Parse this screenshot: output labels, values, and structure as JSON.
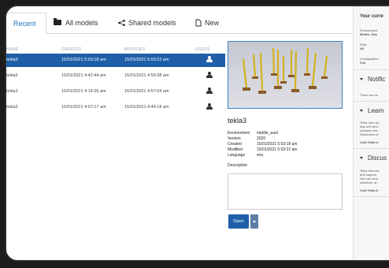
{
  "tabs": [
    {
      "label": "Recent",
      "icon": "clock-icon"
    },
    {
      "label": "All models",
      "icon": "folder-icon"
    },
    {
      "label": "Shared models",
      "icon": "share-icon"
    },
    {
      "label": "New",
      "icon": "new-document-icon"
    }
  ],
  "table": {
    "columns": [
      "NAME",
      "CREATED",
      "MODIFIED",
      "USERS"
    ],
    "rows": [
      {
        "name": "tekla3",
        "created": "15/01/2021 5:03:18 am",
        "modified": "15/01/2021 5:03:22 am",
        "selected": true
      },
      {
        "name": "tekla2",
        "created": "15/01/2021 4:42:44 am",
        "modified": "15/01/2021 4:59:38 am",
        "selected": false
      },
      {
        "name": "tekla1",
        "created": "15/01/2021 4:14:36 am",
        "modified": "15/01/2021 4:57:04 am",
        "selected": false
      },
      {
        "name": "tekla2",
        "created": "15/01/2021 4:07:17 am",
        "modified": "15/01/2021 4:44:18 am",
        "selected": false
      }
    ]
  },
  "details": {
    "title": "tekla3",
    "environment_label": "Environment",
    "environment": "middle_east",
    "version_label": "Version",
    "version": "2020",
    "created_label": "Created",
    "created": "15/01/2021 5:03:18 am",
    "modified_label": "Modified",
    "modified": "15/01/2021 5:03:22 am",
    "language_label": "Language",
    "language": "enu",
    "description_label": "Description",
    "open_label": "Open"
  },
  "right_panel": {
    "header": "Your curre",
    "environment_label": "Environment",
    "environment_value": "Middle_Eas",
    "role_label": "Role:",
    "role_value": "All",
    "configuration_label": "Configuration",
    "configuration_value": "Full",
    "notifications_title": "Notific",
    "notifications_text": "There are no",
    "learn_title": "Learn",
    "learn_lines": [
      "Tekla User As",
      "fast self servi",
      "contains ans",
      "Structures us"
    ],
    "learn_link": "Visit Tekla U",
    "discuss_title": "Discus",
    "discuss_lines": [
      "Tekla Discuss",
      "and support",
      "You can sear",
      "solutions, an"
    ],
    "discuss_link": "Visit Tekla D"
  },
  "colors": {
    "accent": "#1e5fa8",
    "link": "#1a74c2"
  }
}
